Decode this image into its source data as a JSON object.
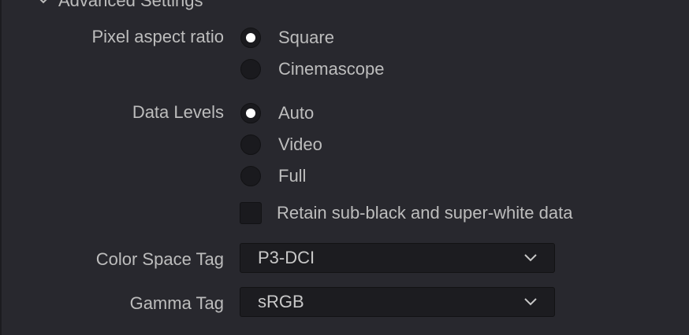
{
  "section": {
    "title": "Advanced Settings"
  },
  "pixel_aspect_ratio": {
    "label": "Pixel aspect ratio",
    "options": [
      {
        "label": "Square",
        "selected": true
      },
      {
        "label": "Cinemascope",
        "selected": false
      }
    ]
  },
  "data_levels": {
    "label": "Data Levels",
    "options": [
      {
        "label": "Auto",
        "selected": true
      },
      {
        "label": "Video",
        "selected": false
      },
      {
        "label": "Full",
        "selected": false
      }
    ],
    "retain_checkbox": {
      "label": "Retain sub-black and super-white data",
      "checked": false
    }
  },
  "color_space_tag": {
    "label": "Color Space Tag",
    "value": "P3-DCI"
  },
  "gamma_tag": {
    "label": "Gamma Tag",
    "value": "sRGB"
  },
  "icons": {
    "section_toggle": "chevron-down-icon",
    "dropdown_arrow": "chevron-down-icon"
  },
  "colors": {
    "background": "#28282e",
    "control_fill": "#1a1a1e",
    "text": "#bdbdbd",
    "radio_dot": "#ffffff"
  }
}
